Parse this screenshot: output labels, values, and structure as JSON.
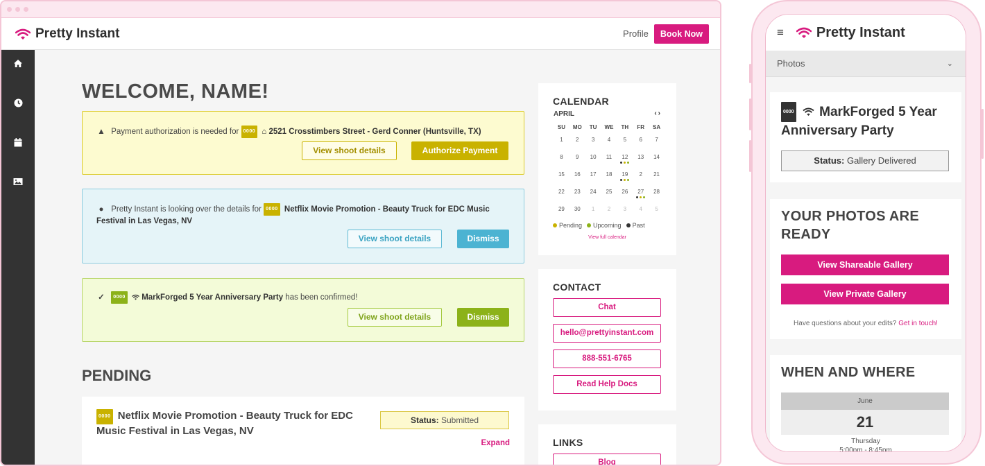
{
  "colors": {
    "brand": "#d81b7f",
    "warning": "#c9b200",
    "info": "#4cb3d2",
    "success": "#8cb219",
    "sidebar": "#333333"
  },
  "desktop": {
    "brand": "Pretty Instant",
    "nav": {
      "profile": "Profile",
      "book_now": "Book Now"
    },
    "sidebar": [
      {
        "icon": "home-icon"
      },
      {
        "icon": "clock-icon"
      },
      {
        "icon": "calendar-icon"
      },
      {
        "icon": "image-icon"
      }
    ],
    "welcome": "WELCOME, NAME!",
    "alerts": {
      "payment": {
        "icon": "▲",
        "text": "Payment authorization is needed for",
        "code": "0000",
        "home_glyph": "⌂",
        "shoot": "2521 Crosstimbers Street - Gerd Conner (Huntsville, TX)",
        "secondary": "View shoot details",
        "primary": "Authorize Payment"
      },
      "review": {
        "icon": "●",
        "text": "Pretty Instant is looking over the details for",
        "code": "0000",
        "shoot": "Netflix Movie Promotion - Beauty Truck for EDC Music Festival in Las Vegas, NV",
        "secondary": "View shoot details",
        "primary": "Dismiss"
      },
      "confirmed": {
        "icon": "✓",
        "code": "0000",
        "shoot": "MarkForged 5 Year Anniversary Party",
        "text_after": "has been confirmed!",
        "secondary": "View shoot details",
        "primary": "Dismiss"
      }
    },
    "pending": {
      "heading": "PENDING",
      "code": "0000",
      "title": "Netflix Movie Promotion - Beauty Truck for EDC Music Festival in Las Vegas, NV",
      "status_label": "Status:",
      "status_value": "Submitted",
      "expand": "Expand"
    },
    "calendar": {
      "heading": "CALENDAR",
      "month": "APRIL",
      "nav": "‹›",
      "weekdays": [
        "SU",
        "MO",
        "TU",
        "WE",
        "TH",
        "FR",
        "SA"
      ],
      "days": [
        {
          "d": "1"
        },
        {
          "d": "2"
        },
        {
          "d": "3"
        },
        {
          "d": "4"
        },
        {
          "d": "5"
        },
        {
          "d": "6"
        },
        {
          "d": "7"
        },
        {
          "d": "8"
        },
        {
          "d": "9"
        },
        {
          "d": "10"
        },
        {
          "d": "11"
        },
        {
          "d": "12",
          "dots": [
            "past",
            "pending",
            "upcoming"
          ]
        },
        {
          "d": "13"
        },
        {
          "d": "14"
        },
        {
          "d": "15"
        },
        {
          "d": "16"
        },
        {
          "d": "17"
        },
        {
          "d": "18"
        },
        {
          "d": "19",
          "dots": [
            "past",
            "pending",
            "upcoming"
          ]
        },
        {
          "d": "2"
        },
        {
          "d": "21"
        },
        {
          "d": "22"
        },
        {
          "d": "23"
        },
        {
          "d": "24"
        },
        {
          "d": "25"
        },
        {
          "d": "26"
        },
        {
          "d": "27",
          "dots": [
            "past",
            "pending",
            "upcoming"
          ]
        },
        {
          "d": "28"
        },
        {
          "d": "29"
        },
        {
          "d": "30"
        },
        {
          "d": "1",
          "muted": true
        },
        {
          "d": "2",
          "muted": true
        },
        {
          "d": "3",
          "muted": true
        },
        {
          "d": "4",
          "muted": true
        },
        {
          "d": "5",
          "muted": true
        }
      ],
      "legend": [
        {
          "label": "Pending",
          "color": "#c9b200"
        },
        {
          "label": "Upcoming",
          "color": "#8cb219"
        },
        {
          "label": "Past",
          "color": "#333333"
        }
      ],
      "dot_colors": {
        "pending": "#c9b200",
        "upcoming": "#8cb219",
        "past": "#333333"
      },
      "full_link": "View full calendar"
    },
    "contact": {
      "heading": "CONTACT",
      "buttons": [
        "Chat",
        "hello@prettyinstant.com",
        "888-551-6765",
        "Read Help Docs"
      ]
    },
    "links": {
      "heading": "LINKS",
      "blog": "Blog"
    }
  },
  "mobile": {
    "menu_icon": "≡",
    "brand": "Pretty Instant",
    "select": "Photos",
    "shoot": {
      "code": "0000",
      "title": "MarkForged 5 Year Anniversary Party",
      "status_label": "Status:",
      "status_value": "Gallery Delivered"
    },
    "photos": {
      "heading": "YOUR PHOTOS ARE READY",
      "shareable": "View Shareable Gallery",
      "private": "View Private Gallery",
      "question": "Have questions about your edits?",
      "contact_link": "Get in touch!"
    },
    "where": {
      "heading": "WHEN AND WHERE",
      "month": "June",
      "day": "21",
      "weekday": "Thursday",
      "time": "5:00pm - 8:45pm"
    }
  }
}
